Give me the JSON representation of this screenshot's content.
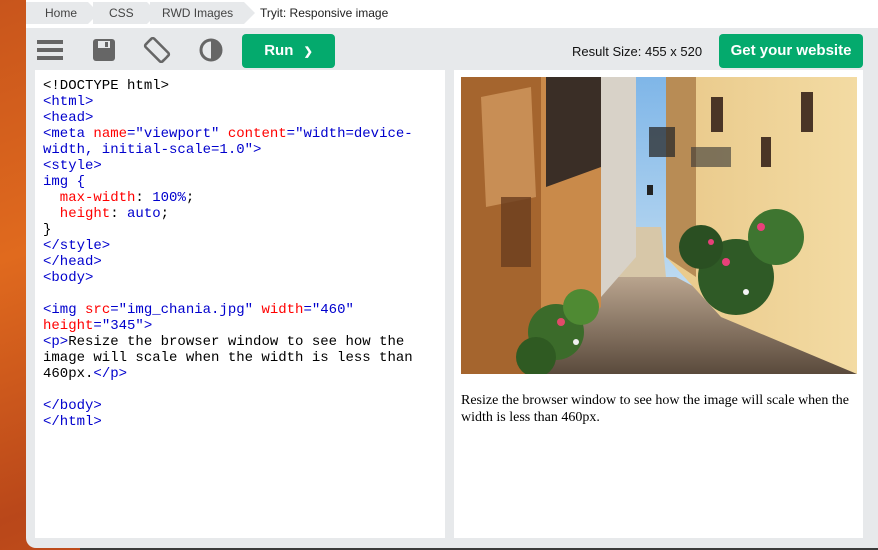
{
  "breadcrumb": [
    "Home",
    "CSS",
    "RWD Images",
    "Tryit: Responsive image"
  ],
  "toolbar": {
    "icons": [
      "menu-icon",
      "save-icon",
      "rotate-icon",
      "contrast-icon"
    ],
    "run_label": "Run",
    "run_chevron": "❯",
    "result_size": "Result Size: 455 x 520",
    "get_website_label": "Get your website"
  },
  "code": {
    "l1": "<!DOCTYPE html>",
    "l2": "<html>",
    "l3": "<head>",
    "l4a": "<meta",
    "l4b": " name",
    "l4c": "=\"viewport\"",
    "l4d": " content",
    "l4e": "=\"width=device-",
    "l5a": "width, initial-scale=1.0\"",
    "l5b": ">",
    "l6": "<style>",
    "l7": "img {",
    "l8a": "  max-width",
    "l8b": ": ",
    "l8c": "100%",
    "l8d": ";",
    "l9a": "  height",
    "l9b": ": ",
    "l9c": "auto",
    "l9d": ";",
    "l10": "}",
    "l11": "</style>",
    "l12": "</head>",
    "l13": "<body>",
    "l15a": "<img",
    "l15b": " src",
    "l15c": "=\"img_chania.jpg\"",
    "l15d": " width",
    "l15e": "=\"460\"",
    "l16a": "height",
    "l16b": "=\"345\"",
    "l16c": ">",
    "l17a": "<p>",
    "l17b": "Resize the browser window to see how the",
    "l18": "image will scale when the width is less than",
    "l19a": "460px.",
    "l19b": "</p>",
    "l21": "</body>",
    "l22": "</html>"
  },
  "result": {
    "image_alt": "Narrow street in Chania",
    "text": "Resize the browser window to see how the image will scale when the width is less than 460px."
  }
}
